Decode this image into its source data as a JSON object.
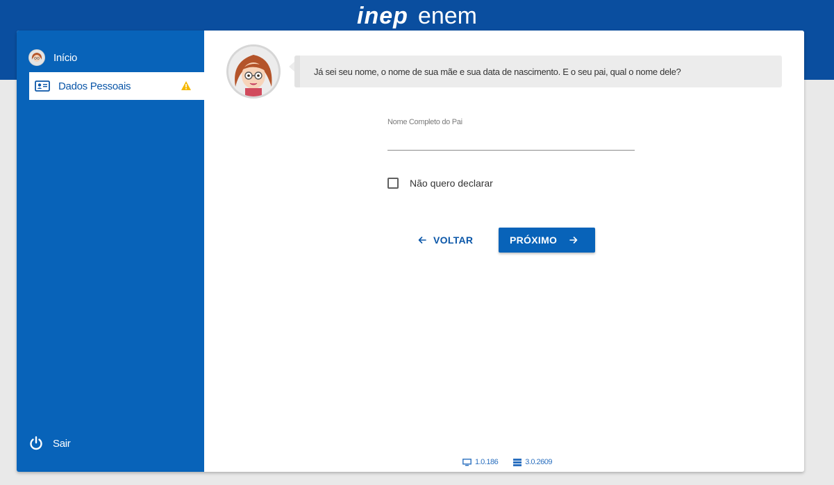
{
  "header": {
    "logo_part1": "inep",
    "logo_part2": "enem"
  },
  "sidebar": {
    "items": [
      {
        "label": "Início",
        "icon": "assistant-avatar-icon"
      },
      {
        "label": "Dados Pessoais",
        "icon": "id-card-icon",
        "status_icon": "warning-icon"
      }
    ],
    "logout_label": "Sair"
  },
  "assistant": {
    "message": "Já sei seu nome, o nome de sua mãe e sua data de nascimento. E o seu pai, qual o nome dele?"
  },
  "form": {
    "father_name_label": "Nome Completo do Pai",
    "father_name_value": "",
    "decline_label": "Não quero declarar",
    "decline_checked": false
  },
  "buttons": {
    "back_label": "VOLTAR",
    "next_label": "PRÓXIMO"
  },
  "footer": {
    "client_version": "1.0.186",
    "server_version": "3.0.2609"
  },
  "colors": {
    "brand_blue": "#0863b9",
    "header_blue": "#0a4e9f",
    "warning": "#f5b800"
  }
}
